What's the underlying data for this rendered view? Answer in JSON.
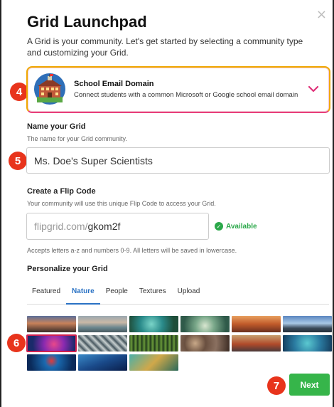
{
  "dialog": {
    "title": "Grid Launchpad",
    "subtitle": "A Grid is your community. Let's get started by selecting a community type and customizing your Grid.",
    "close_label": "×"
  },
  "community_type": {
    "title": "School Email Domain",
    "description": "Connect students with a common Microsoft or Google school email domain",
    "icon": "school-building-icon",
    "border_colors": [
      "#f0a800",
      "#e8407c"
    ]
  },
  "steps": {
    "four": "4",
    "five": "5",
    "six": "6",
    "seven": "7"
  },
  "grid_name": {
    "label": "Name your Grid",
    "hint": "The name for your Grid community.",
    "value": "Ms. Doe's Super Scientists"
  },
  "flip_code": {
    "label": "Create a Flip Code",
    "hint": "Your community will use this unique Flip Code to access your Grid.",
    "prefix": "flipgrid.com/",
    "value": "gkom2f",
    "status": "Available",
    "rules": "Accepts letters a-z and numbers 0-9. All letters will be saved in lowercase."
  },
  "personalize": {
    "label": "Personalize your Grid",
    "tabs": [
      {
        "label": "Featured",
        "active": false
      },
      {
        "label": "Nature",
        "active": true
      },
      {
        "label": "People",
        "active": false
      },
      {
        "label": "Textures",
        "active": false
      },
      {
        "label": "Upload",
        "active": false
      }
    ],
    "selected_tile": 6
  },
  "colors": {
    "accent_blue": "#2a72c4",
    "success_green": "#36b54a",
    "badge_red": "#e8341c"
  },
  "actions": {
    "next_label": "Next"
  }
}
